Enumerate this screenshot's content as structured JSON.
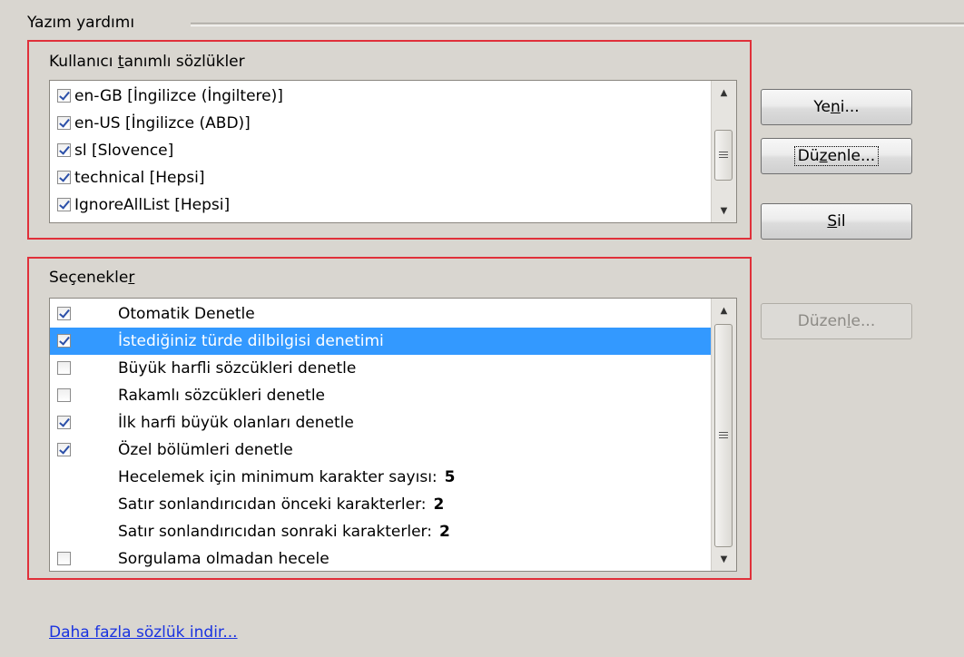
{
  "group": {
    "title": "Yazım yardımı"
  },
  "dictionaries": {
    "label_before": "Kullanıcı ",
    "label_mnemonic": "t",
    "label_after": "anımlı sözlükler",
    "items": [
      {
        "label": "en-GB [İngilizce (İngiltere)]",
        "checked": true
      },
      {
        "label": "en-US [İngilizce (ABD)]",
        "checked": true
      },
      {
        "label": "sl [Slovence]",
        "checked": true
      },
      {
        "label": "technical [Hepsi]",
        "checked": true
      },
      {
        "label": "IgnoreAllList [Hepsi]",
        "checked": true
      }
    ]
  },
  "buttons": {
    "new": {
      "before": "Ye",
      "mnemonic": "n",
      "after": "i..."
    },
    "edit": {
      "before": "Dü",
      "mnemonic": "z",
      "after": "enle..."
    },
    "delete": {
      "before": "",
      "mnemonic": "S",
      "after": "il"
    },
    "edit_options": {
      "before": "Düzen",
      "mnemonic": "l",
      "after": "e..."
    }
  },
  "options": {
    "label_before": "Seçenekle",
    "label_mnemonic": "r",
    "items": [
      {
        "label": "Otomatik Denetle",
        "checked": true
      },
      {
        "label": "İstediğiniz türde dilbilgisi denetimi",
        "checked": true,
        "selected": true
      },
      {
        "label": "Büyük harfli sözcükleri denetle",
        "checked": false
      },
      {
        "label": "Rakamlı sözcükleri denetle",
        "checked": false
      },
      {
        "label": "İlk harfi büyük olanları denetle",
        "checked": true
      },
      {
        "label": "Özel bölümleri denetle",
        "checked": true
      },
      {
        "label": "Hecelemek için minimum karakter sayısı:",
        "value": "5"
      },
      {
        "label": "Satır sonlandırıcıdan önceki karakterler:",
        "value": "2"
      },
      {
        "label": "Satır sonlandırıcıdan sonraki karakterler:",
        "value": "2"
      },
      {
        "label": "Sorgulama olmadan hecele",
        "checked": false
      }
    ]
  },
  "link": {
    "text": "Daha fazla sözlük indir..."
  },
  "colors": {
    "highlight": "#3399ff",
    "annotation_frame": "#e0303a",
    "link": "#1a33e0"
  }
}
